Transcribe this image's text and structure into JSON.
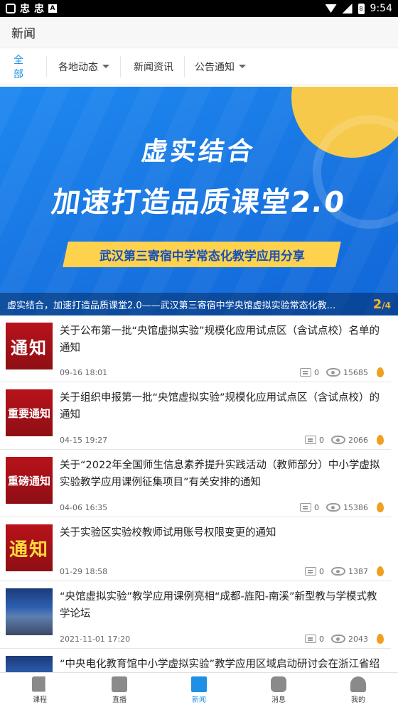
{
  "status_bar": {
    "time": "9:54",
    "icons": [
      "wifi-icon",
      "signal-icon",
      "battery-icon"
    ],
    "battery_label": "8"
  },
  "header": {
    "title": "新闻"
  },
  "tabs": [
    {
      "label": "全部",
      "active": true,
      "dropdown": false
    },
    {
      "label": "各地动态",
      "active": false,
      "dropdown": true
    },
    {
      "label": "新闻资讯",
      "active": false,
      "dropdown": false
    },
    {
      "label": "公告通知",
      "active": false,
      "dropdown": true
    }
  ],
  "banner": {
    "headline1": "虚实结合",
    "headline2": "加速打造品质课堂2.0",
    "ribbon": "武汉第三寄宿中学常态化教学应用分享",
    "caption": "虚实结合，加速打造品质课堂2.0——武汉第三寄宿中学央馆虚拟实验常态化教...",
    "page_current": "2",
    "page_total": "/4"
  },
  "news": [
    {
      "thumb": "通知",
      "title": "关于公布第一批“央馆虚拟实验”规模化应用试点区（含试点校）名单的通知",
      "date": "09-16 18:01",
      "comments": "0",
      "views": "15685"
    },
    {
      "thumb": "重要通知",
      "title": "关于组织申报第一批“央馆虚拟实验”规模化应用试点区（含试点校）的通知",
      "date": "04-15 19:27",
      "comments": "0",
      "views": "2066"
    },
    {
      "thumb": "重磅通知",
      "title": "关于“2022年全国师生信息素养提升实践活动（教师部分）中小学虚拟实验教学应用课例征集项目”有关安排的通知",
      "date": "04-06 16:35",
      "comments": "0",
      "views": "15386"
    },
    {
      "thumb": "通知",
      "title": "关于实验区实验校教师试用账号权限变更的通知",
      "date": "01-29 18:58",
      "comments": "0",
      "views": "1387"
    },
    {
      "thumb": "",
      "title": "“央馆虚拟实验”教学应用课例亮相“成都-旌阳-南溪”新型教与学模式教学论坛",
      "date": "2021-11-01 17:20",
      "comments": "0",
      "views": "2043"
    },
    {
      "thumb": "",
      "title": "“中央电化教育馆中小学虚拟实验”教学应用区域启动研讨会在浙江省绍",
      "date": "",
      "comments": "",
      "views": ""
    }
  ],
  "bottom_nav": [
    {
      "label": "课程",
      "active": false
    },
    {
      "label": "直播",
      "active": false
    },
    {
      "label": "新闻",
      "active": true
    },
    {
      "label": "消息",
      "active": false
    },
    {
      "label": "我的",
      "active": false
    }
  ]
}
